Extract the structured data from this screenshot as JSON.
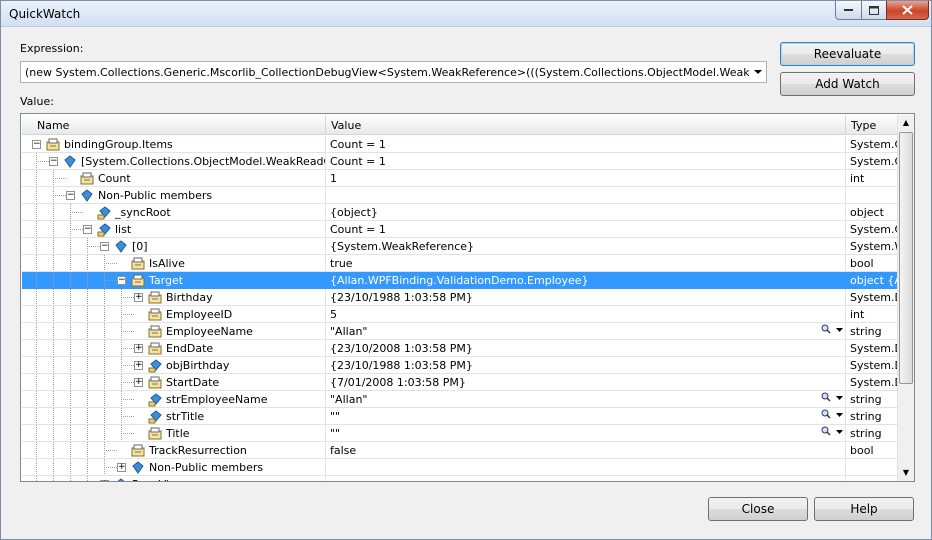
{
  "window": {
    "title": "QuickWatch"
  },
  "expression": {
    "label": "Expression:",
    "value": "(new System.Collections.Generic.Mscorlib_CollectionDebugView<System.WeakReference>(((System.Collections.ObjectModel.WeakReadO"
  },
  "value_label": "Value:",
  "buttons": {
    "reevaluate": "Reevaluate",
    "add_watch": "Add Watch",
    "close": "Close",
    "help": "Help"
  },
  "grid": {
    "columns": {
      "name": "Name",
      "value": "Value",
      "type": "Type"
    },
    "rows": [
      {
        "name": "bindingGroup.Items",
        "value": "Count = 1",
        "type": "System.C",
        "depth": 0,
        "exp": "-",
        "icon": "property"
      },
      {
        "name": "[System.Collections.ObjectModel.WeakReadOnlyC",
        "value": "Count = 1",
        "type": "System.C",
        "depth": 1,
        "exp": "-",
        "icon": "field"
      },
      {
        "name": "Count",
        "value": "1",
        "type": "int",
        "depth": 2,
        "exp": "",
        "icon": "property"
      },
      {
        "name": "Non-Public members",
        "value": "",
        "type": "",
        "depth": 2,
        "exp": "-",
        "icon": "field"
      },
      {
        "name": "_syncRoot",
        "value": "{object}",
        "type": "object",
        "depth": 3,
        "exp": "",
        "icon": "private-field"
      },
      {
        "name": "list",
        "value": "Count = 1",
        "type": "System.C",
        "depth": 3,
        "exp": "-",
        "icon": "private-field"
      },
      {
        "name": "[0]",
        "value": "{System.WeakReference}",
        "type": "System.W",
        "depth": 4,
        "exp": "-",
        "icon": "field"
      },
      {
        "name": "IsAlive",
        "value": "true",
        "type": "bool",
        "depth": 5,
        "exp": "",
        "icon": "property"
      },
      {
        "name": "Target",
        "value": "{Allan.WPFBinding.ValidationDemo.Employee}",
        "type": "object {A",
        "depth": 5,
        "exp": "-",
        "icon": "property",
        "selected": true
      },
      {
        "name": "Birthday",
        "value": "{23/10/1988 1:03:58 PM}",
        "type": "System.D",
        "depth": 6,
        "exp": "+",
        "icon": "property"
      },
      {
        "name": "EmployeeID",
        "value": "5",
        "type": "int",
        "depth": 6,
        "exp": "",
        "icon": "property"
      },
      {
        "name": "EmployeeName",
        "value": "\"Allan\"",
        "type": "string",
        "depth": 6,
        "exp": "",
        "icon": "property",
        "mag": true
      },
      {
        "name": "EndDate",
        "value": "{23/10/2008 1:03:58 PM}",
        "type": "System.D",
        "depth": 6,
        "exp": "+",
        "icon": "property"
      },
      {
        "name": "objBirthday",
        "value": "{23/10/1988 1:03:58 PM}",
        "type": "System.D",
        "depth": 6,
        "exp": "+",
        "icon": "private-field"
      },
      {
        "name": "StartDate",
        "value": "{7/01/2008 1:03:58 PM}",
        "type": "System.D",
        "depth": 6,
        "exp": "+",
        "icon": "property"
      },
      {
        "name": "strEmployeeName",
        "value": "\"Allan\"",
        "type": "string",
        "depth": 6,
        "exp": "",
        "icon": "private-field",
        "mag": true
      },
      {
        "name": "strTitle",
        "value": "\"\"",
        "type": "string",
        "depth": 6,
        "exp": "",
        "icon": "private-field",
        "mag": true
      },
      {
        "name": "Title",
        "value": "\"\"",
        "type": "string",
        "depth": 6,
        "exp": "",
        "icon": "property",
        "mag": true
      },
      {
        "name": "TrackResurrection",
        "value": "false",
        "type": "bool",
        "depth": 5,
        "exp": "",
        "icon": "property"
      },
      {
        "name": "Non-Public members",
        "value": "",
        "type": "",
        "depth": 5,
        "exp": "+",
        "icon": "field"
      },
      {
        "name": "Raw View",
        "value": "",
        "type": "",
        "depth": 4,
        "exp": "+",
        "icon": "field"
      }
    ]
  }
}
